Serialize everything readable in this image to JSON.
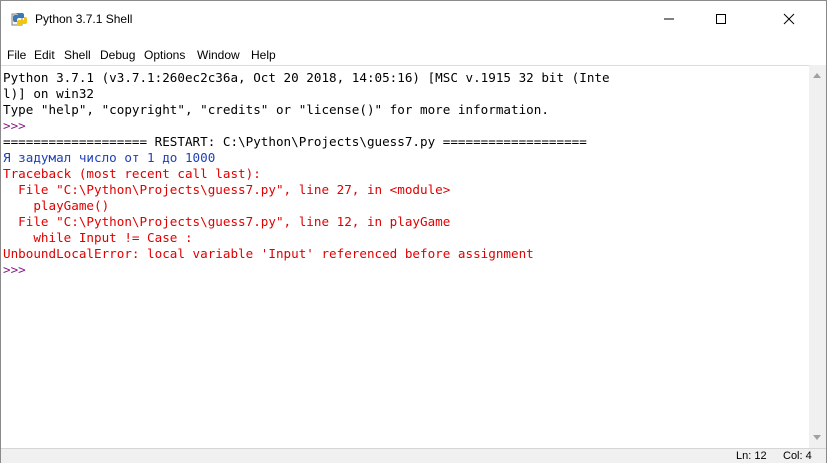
{
  "window": {
    "title": "Python 3.7.1 Shell"
  },
  "menu": [
    "File",
    "Edit",
    "Shell",
    "Debug",
    "Options",
    "Window",
    "Help"
  ],
  "shell": {
    "lines": [
      {
        "text": "Python 3.7.1 (v3.7.1:260ec2c36a, Oct 20 2018, 14:05:16) [MSC v.1915 32 bit (Inte",
        "color": "#000000"
      },
      {
        "text": "l)] on win32",
        "color": "#000000"
      },
      {
        "text": "Type \"help\", \"copyright\", \"credits\" or \"license()\" for more information.",
        "color": "#000000"
      },
      {
        "text": ">>> ",
        "color": "#8a1a8a"
      },
      {
        "text": "=================== RESTART: C:\\Python\\Projects\\guess7.py ===================",
        "color": "#000000"
      },
      {
        "text": "Я задумал число от 1 до 1000",
        "color": "#1f3fb8"
      },
      {
        "text": "Traceback (most recent call last):",
        "color": "#e00000"
      },
      {
        "text": "  File \"C:\\Python\\Projects\\guess7.py\", line 27, in <module>",
        "color": "#e00000"
      },
      {
        "text": "    playGame()",
        "color": "#e00000"
      },
      {
        "text": "  File \"C:\\Python\\Projects\\guess7.py\", line 12, in playGame",
        "color": "#e00000"
      },
      {
        "text": "    while Input != Case :",
        "color": "#e00000"
      },
      {
        "text": "UnboundLocalError: local variable 'Input' referenced before assignment",
        "color": "#e00000"
      },
      {
        "text": ">>> ",
        "color": "#8a1a8a"
      }
    ]
  },
  "status": {
    "line": "Ln: 12",
    "col": "Col: 4"
  },
  "icons": {
    "app": "python-idle-icon",
    "minimize": "minimize-icon",
    "maximize": "maximize-icon",
    "close": "close-icon"
  }
}
